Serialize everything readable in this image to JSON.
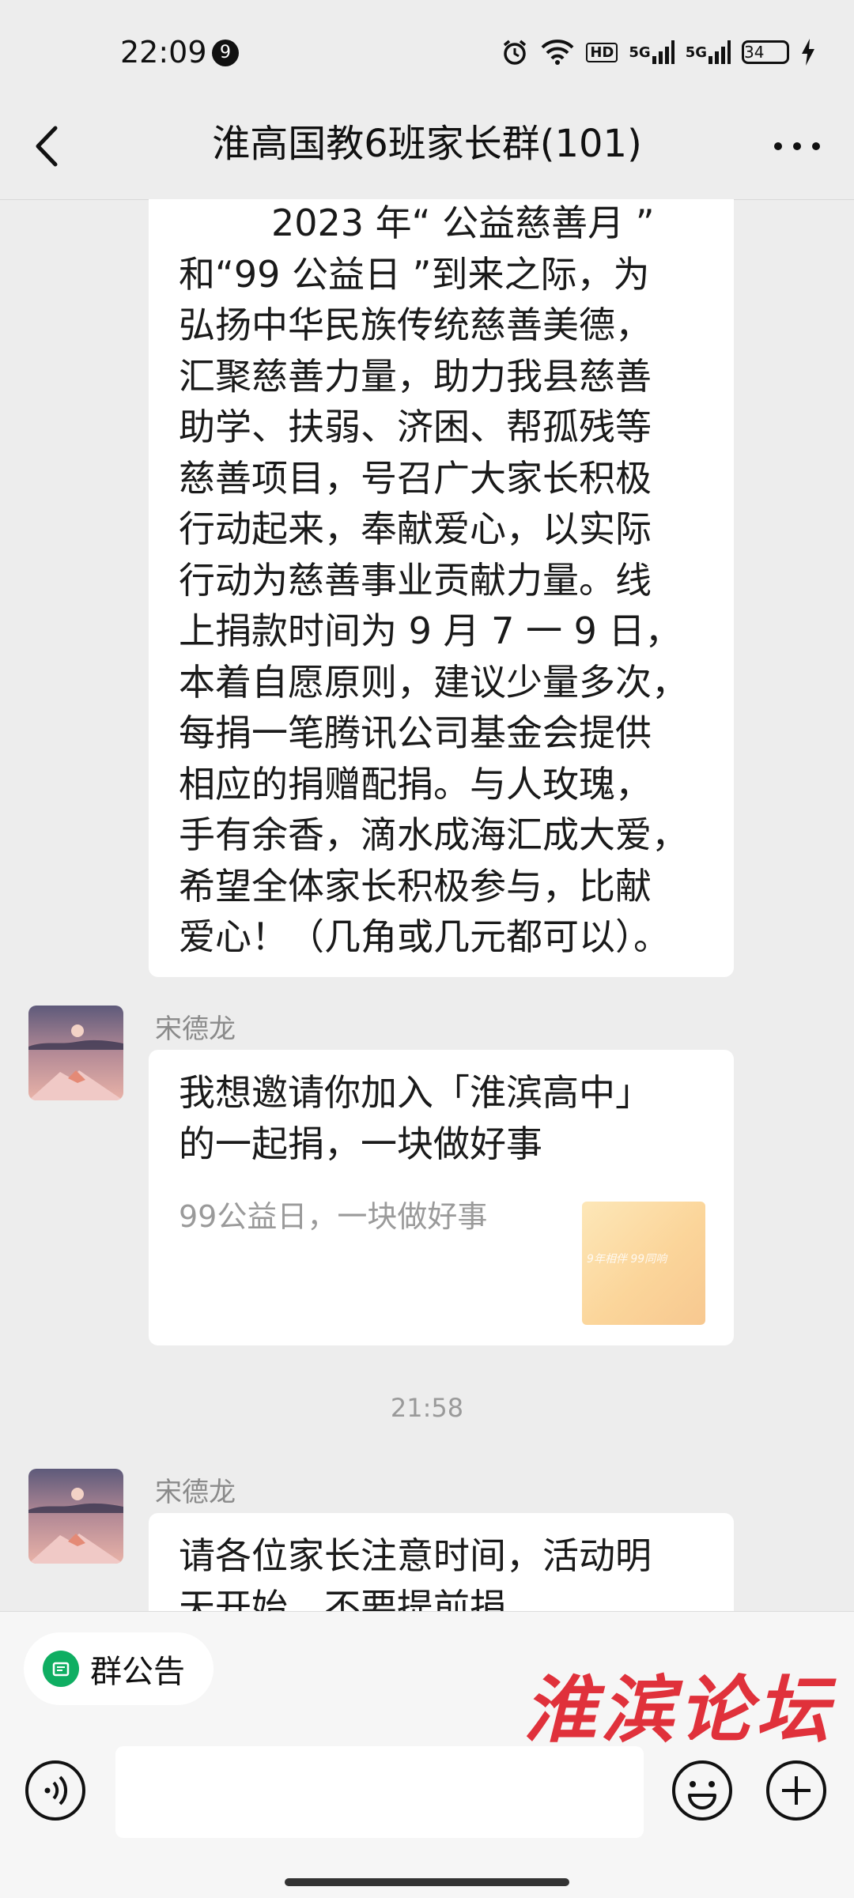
{
  "status_bar": {
    "time": "22:09",
    "notification_count": "9",
    "hd_tag": "HD",
    "net_tag_1": "5G",
    "net_tag_2": "5G",
    "battery": "34",
    "icons": [
      "alarm-icon",
      "wifi-icon",
      "hd-icon",
      "signal-5g-icon",
      "signal-5g-icon",
      "battery-icon",
      "charging-icon"
    ]
  },
  "header": {
    "title": "淮高国教6班家长群(101)",
    "icons": [
      "back-icon",
      "more-icon"
    ]
  },
  "messages": [
    {
      "type": "text",
      "lines": [
        "        2023 年“ 公益慈善月 ”",
        "和“99 公益日 ”到来之际，为",
        "弘扬中华民族传统慈善美德，",
        "汇聚慈善力量，助力我县慈善",
        "助学、扶弱、济困、帮孤残等",
        "慈善项目，号召广大家长积极",
        "行动起来，奉献爱心，以实际",
        "行动为慈善事业贡献力量。线",
        "上捐款时间为 9 月 7 一 9 日，",
        "本着自愿原则，建议少量多次，",
        "每捐一笔腾讯公司基金会提供",
        "相应的捐赠配捐。与人玫瑰，",
        "手有余香，滴水成海汇成大爱，",
        "希望全体家长积极参与，比献",
        "爱心！（几角或几元都可以）。"
      ]
    },
    {
      "type": "card",
      "sender": "宋德龙",
      "title_lines": [
        "我想邀请你加入「淮滨高中」",
        "的一起捐，一块做好事"
      ],
      "subtitle": "99公益日，一块做好事",
      "thumb_text": "9年相伴 99同响"
    },
    {
      "type": "time",
      "time": "21:58"
    },
    {
      "type": "text",
      "sender": "宋德龙",
      "lines": [
        "请各位家长注意时间，活动明",
        "天开始，不要提前捐"
      ]
    }
  ],
  "footer": {
    "announcement_label": "群公告",
    "watermark": "淮滨论坛",
    "icons": [
      "voice-icon",
      "emoji-icon",
      "plus-icon"
    ]
  },
  "colors": {
    "background": "#ededed",
    "bubble": "#ffffff",
    "accent_green": "#0fae62",
    "watermark_red": "#e0313b"
  }
}
